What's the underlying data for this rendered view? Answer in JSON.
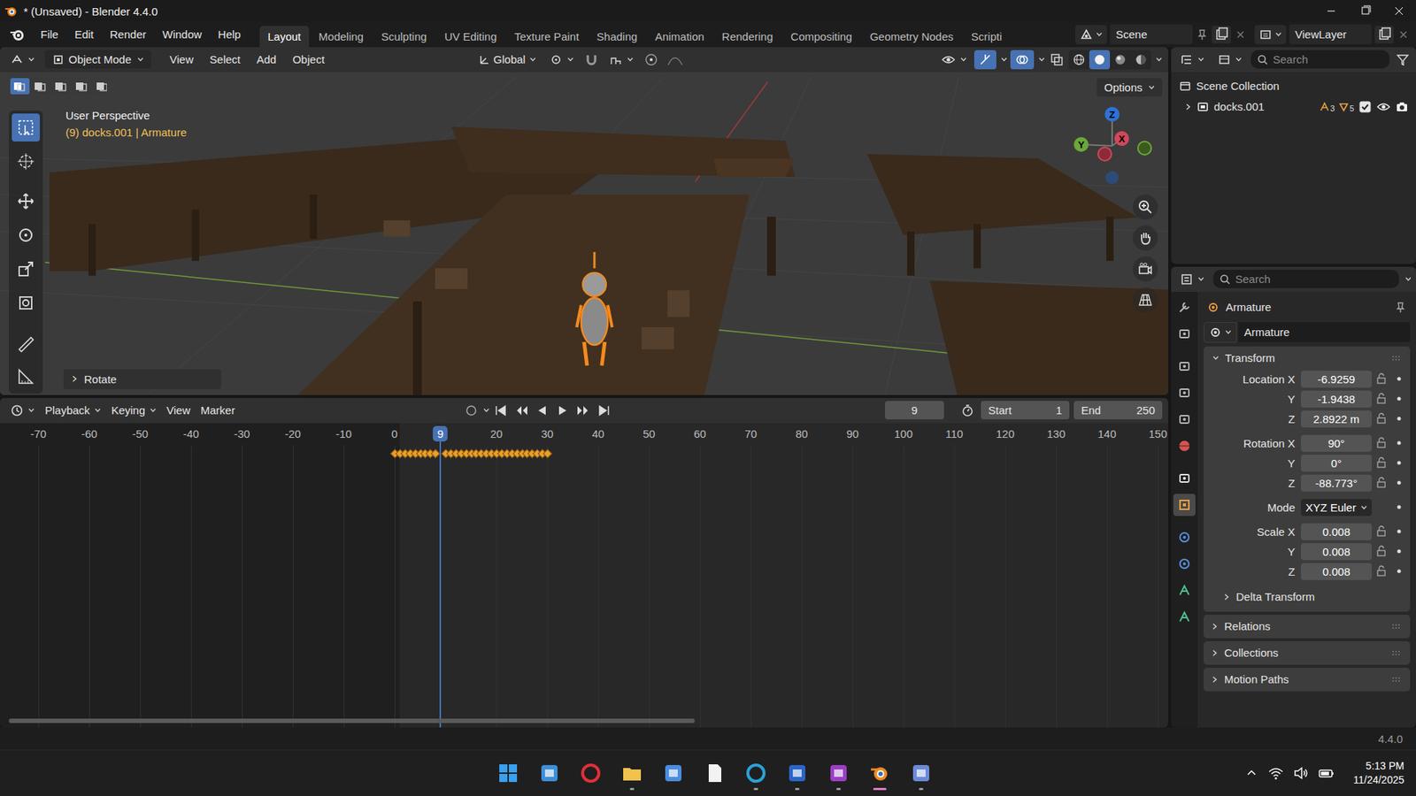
{
  "window": {
    "title": "* (Unsaved) - Blender 4.4.0"
  },
  "menu": [
    "File",
    "Edit",
    "Render",
    "Window",
    "Help"
  ],
  "workspaces": [
    {
      "label": "Layout",
      "selected": true
    },
    {
      "label": "Modeling",
      "selected": false
    },
    {
      "label": "Sculpting",
      "selected": false
    },
    {
      "label": "UV Editing",
      "selected": false
    },
    {
      "label": "Texture Paint",
      "selected": false
    },
    {
      "label": "Shading",
      "selected": false
    },
    {
      "label": "Animation",
      "selected": false
    },
    {
      "label": "Rendering",
      "selected": false
    },
    {
      "label": "Compositing",
      "selected": false
    },
    {
      "label": "Geometry Nodes",
      "selected": false
    },
    {
      "label": "Scripti",
      "selected": false
    }
  ],
  "scene": {
    "name": "Scene"
  },
  "view_layer": {
    "name": "ViewLayer"
  },
  "viewport": {
    "mode": "Object Mode",
    "menus": [
      "View",
      "Select",
      "Add",
      "Object"
    ],
    "orientation": "Global",
    "select_modes": [
      {
        "selected": true
      },
      {
        "selected": false
      },
      {
        "selected": false
      },
      {
        "selected": false
      },
      {
        "selected": false
      }
    ],
    "shading": [
      {
        "kind": "wireframe",
        "selected": false
      },
      {
        "kind": "solid",
        "selected": true
      },
      {
        "kind": "material",
        "selected": false
      },
      {
        "kind": "rendered",
        "selected": false
      }
    ],
    "view_name": "User Perspective",
    "context": "(9) docks.001 | Armature",
    "options": "Options",
    "last_operator": "Rotate",
    "gizmo": {
      "x": "X",
      "y": "Y",
      "z": "Z"
    },
    "tools": [
      {
        "kind": "select",
        "selected": true
      },
      {
        "kind": "cursor",
        "selected": false
      },
      {
        "kind": "move",
        "selected": false
      },
      {
        "kind": "rotate",
        "selected": false
      },
      {
        "kind": "scale",
        "selected": false
      },
      {
        "kind": "transform",
        "selected": false
      },
      {
        "kind": "annotate",
        "selected": false
      },
      {
        "kind": "measure",
        "selected": false
      }
    ]
  },
  "timeline": {
    "menus": [
      {
        "label": "Playback",
        "dropdown": true
      },
      {
        "label": "Keying",
        "dropdown": true
      },
      {
        "label": "View",
        "dropdown": false
      },
      {
        "label": "Marker",
        "dropdown": false
      }
    ],
    "current_frame": "9",
    "start": {
      "label": "Start",
      "value": "1"
    },
    "end": {
      "label": "End",
      "value": "250"
    },
    "ticks": [
      "-70",
      "-60",
      "-50",
      "-40",
      "-30",
      "-20",
      "-10",
      "0",
      "20",
      "30",
      "40",
      "50",
      "60",
      "70",
      "80",
      "90",
      "100",
      "110",
      "120",
      "130",
      "140",
      "150"
    ],
    "keyframes": [
      0,
      1,
      2,
      3,
      4,
      5,
      6,
      7,
      8,
      9,
      10,
      11,
      12,
      13,
      14,
      15,
      16,
      17,
      18,
      19,
      20,
      21,
      22,
      23,
      24,
      25,
      26,
      27,
      28,
      29,
      30
    ]
  },
  "outliner": {
    "search_placeholder": "Search",
    "root": "Scene Collection",
    "items": [
      {
        "name": "docks.001",
        "expanded": false,
        "counts": [
          "3",
          "5"
        ],
        "checked": true,
        "visible": true,
        "renderable": true
      }
    ]
  },
  "properties": {
    "search_placeholder": "Search",
    "tabs": [
      {
        "kind": "tool",
        "selected": false
      },
      {
        "kind": "render",
        "selected": false
      },
      {
        "kind": "output",
        "selected": false
      },
      {
        "kind": "view_layer",
        "selected": false
      },
      {
        "kind": "scene",
        "selected": false
      },
      {
        "kind": "world",
        "selected": false
      },
      {
        "kind": "collection",
        "selected": false
      },
      {
        "kind": "object",
        "selected": true
      },
      {
        "kind": "physics",
        "selected": false
      },
      {
        "kind": "constraints",
        "selected": false
      },
      {
        "kind": "data",
        "selected": false
      },
      {
        "kind": "bone",
        "selected": false
      }
    ],
    "object_name": "Armature",
    "datablock": "Armature",
    "panel": {
      "title": "Transform",
      "expanded": true
    },
    "groups": [
      {
        "rows": [
          {
            "label": "Location X",
            "value": "-6.9259",
            "kind": "field"
          },
          {
            "label": "Y",
            "value": "-1.9438",
            "kind": "field"
          },
          {
            "label": "Z",
            "value": "2.8922 m",
            "kind": "field"
          }
        ]
      },
      {
        "rows": [
          {
            "label": "Rotation X",
            "value": "90°",
            "kind": "field"
          },
          {
            "label": "Y",
            "value": "0°",
            "kind": "field"
          },
          {
            "label": "Z",
            "value": "-88.773°",
            "kind": "field"
          }
        ]
      },
      {
        "rows": [
          {
            "label": "Mode",
            "value": "XYZ Euler",
            "kind": "dropdown"
          }
        ]
      },
      {
        "rows": [
          {
            "label": "Scale X",
            "value": "0.008",
            "kind": "field"
          },
          {
            "label": "Y",
            "value": "0.008",
            "kind": "field"
          },
          {
            "label": "Z",
            "value": "0.008",
            "kind": "field"
          }
        ]
      }
    ],
    "subpanels": [
      {
        "title": "Delta Transform",
        "expanded": false
      }
    ],
    "sections": [
      {
        "title": "Relations",
        "expanded": false
      },
      {
        "title": "Collections",
        "expanded": false
      },
      {
        "title": "Motion Paths",
        "expanded": false
      }
    ]
  },
  "status_bar": {
    "version": "4.4.0"
  },
  "taskbar": {
    "apps": [
      {
        "kind": "start",
        "open": false,
        "selected": false
      },
      {
        "kind": "widgets",
        "open": false,
        "selected": false
      },
      {
        "kind": "opera",
        "open": false,
        "selected": false
      },
      {
        "kind": "explorer",
        "open": true,
        "selected": false
      },
      {
        "kind": "store",
        "open": false,
        "selected": false
      },
      {
        "kind": "notes",
        "open": false,
        "selected": false
      },
      {
        "kind": "edge",
        "open": true,
        "selected": false
      },
      {
        "kind": "word",
        "open": true,
        "selected": false
      },
      {
        "kind": "onenote",
        "open": true,
        "selected": false
      },
      {
        "kind": "blender",
        "open": true,
        "selected": true
      },
      {
        "kind": "snip",
        "open": true,
        "selected": false
      }
    ],
    "time": "5:13 PM",
    "date": "11/24/2025"
  }
}
